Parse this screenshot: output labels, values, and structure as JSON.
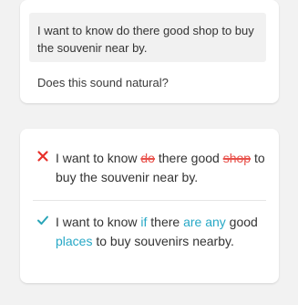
{
  "question_card": {
    "quote_text": "I want to know do there good shop to buy the souvenir near by.",
    "question_text": "Does this sound natural?"
  },
  "correction_card": {
    "wrong": {
      "mark": "cross-icon",
      "seg1": "I want to know ",
      "seg2": "do",
      "seg3": " there good ",
      "seg4": "shop",
      "seg5": " to buy the souvenir near by."
    },
    "right": {
      "mark": "check-icon",
      "seg1": "I want to know ",
      "seg2": "if",
      "seg3": " there ",
      "seg4": "are any",
      "seg5": " good ",
      "seg6": "places",
      "seg7": " to buy souvenirs nearby."
    }
  },
  "colors": {
    "removed": "#e8504a",
    "added": "#27a8c6",
    "check": "#2aa5b8",
    "cross": "#e8302a"
  }
}
